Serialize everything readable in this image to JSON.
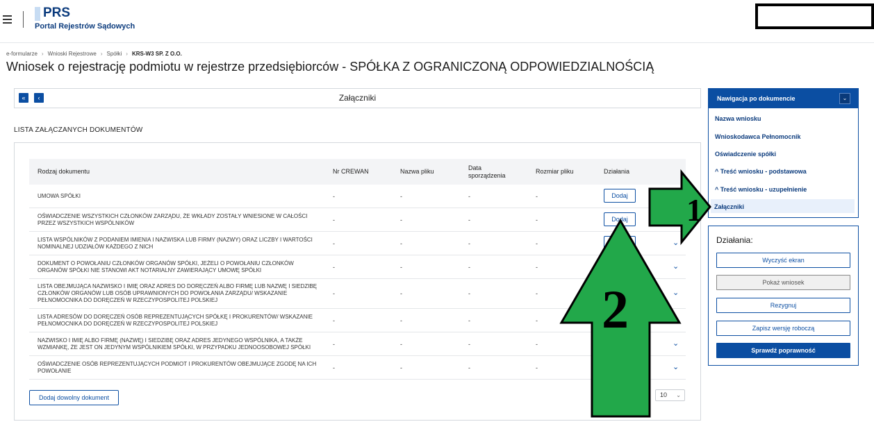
{
  "header": {
    "logo_title": "PRS",
    "logo_subtitle": "Portal Rejestrów Sądowych"
  },
  "breadcrumb": [
    "e-formularze",
    "Wnioski Rejestrowe",
    "Spółki",
    "KRS-W3 SP. Z O.O."
  ],
  "breadcrumb_separator": "›",
  "page_title": "Wniosek o rejestrację podmiotu w rejestrze przedsiębiorców - SPÓŁKA Z OGRANICZONĄ ODPOWIEDZIALNOŚCIĄ",
  "section": {
    "title": "Załączniki",
    "first_icon": "«",
    "prev_icon": "‹"
  },
  "list_heading": "LISTA ZAŁĄCZANYCH DOKUMENTÓW",
  "table": {
    "headers": {
      "doc_type": "Rodzaj dokumentu",
      "crewan": "Nr CREWAN",
      "file_name": "Nazwa pliku",
      "date": "Data sporządzenia",
      "size": "Rozmiar pliku",
      "actions": "Działania"
    },
    "dash": "-",
    "add_label": "Dodaj",
    "chevron": "⌄",
    "rows": [
      {
        "doc": "UMOWA SPÓŁKI"
      },
      {
        "doc": "OŚWIADCZENIE WSZYSTKICH CZŁONKÓW ZARZĄDU, ŻE WKŁADY ZOSTAŁY WNIESIONE W CAŁOŚCI PRZEZ WSZYSTKICH WSPÓLNIKÓW"
      },
      {
        "doc": "LISTA WSPÓLNIKÓW Z PODANIEM IMIENIA I NAZWISKA LUB FIRMY (NAZWY) ORAZ LICZBY I WARTOŚCI NOMINALNEJ UDZIAŁÓW KAŻDEGO Z NICH"
      },
      {
        "doc": "DOKUMENT O POWOŁANIU CZŁONKÓW ORGANÓW SPÓŁKI, JEŻELI O POWOŁANIU CZŁONKÓW ORGANÓW SPÓŁKI NIE STANOWI AKT NOTARIALNY ZAWIERAJĄCY UMOWĘ SPÓŁKI"
      },
      {
        "doc": "LISTA OBEJMUJĄCA NAZWISKO I IMIĘ ORAZ ADRES DO DORĘCZEŃ ALBO FIRMĘ LUB NAZWĘ I SIEDZIBĘ CZŁONKÓW ORGANÓW LUB OSÓB UPRAWNIONYCH DO POWOŁANIA ZARZĄDU/ WSKAZANIE PEŁNOMOCNIKA DO DORĘCZEŃ W RZECZYPOSPOLITEJ POLSKIEJ"
      },
      {
        "doc": "LISTA ADRESÓW DO DORĘCZEŃ OSÓB REPREZENTUJĄCYCH SPÓŁKĘ I PROKURENTÓW/ WSKAZANIE PEŁNOMOCNIKA DO DORĘCZEŃ W RZECZYPOSPOLITEJ POLSKIEJ"
      },
      {
        "doc": "NAZWISKO I IMIĘ ALBO FIRMĘ (NAZWĘ) I SIEDZIBĘ ORAZ ADRES JEDYNEGO WSPÓLNIKA, A TAKŻE WZMIANKĘ, ŻE JEST ON JEDYNYM WSPÓLNIKIEM SPÓŁKI, W PRZYPADKU JEDNOOSOBOWEJ SPÓŁKI"
      },
      {
        "doc": "OŚWIADCZENIE OSÓB REPREZENTUJĄCYCH PODMIOT I PROKURENTÓW OBEJMUJĄCE ZGODĘ NA ICH POWOŁANIE"
      }
    ],
    "add_any_label": "Dodaj dowolny dokument",
    "page_size": "10"
  },
  "nav_panel": {
    "title": "Nawigacja po dokumencie",
    "toggle_icon": "⌄",
    "items": [
      "Nazwa wniosku",
      "Wnioskodawca Pełnomocnik",
      "Oświadczenie spółki",
      "Treść wniosku - podstawowa",
      "Treść wniosku - uzupełnienie",
      "Załączniki"
    ],
    "group_prefix": "^"
  },
  "actions_panel": {
    "title": "Działania:",
    "buttons": [
      "Wyczyść ekran",
      "Pokaż wniosek",
      "Rezygnuj",
      "Zapisz wersję roboczą",
      "Sprawdź poprawność"
    ]
  },
  "annotations": {
    "arrow1_label": "1",
    "arrow2_label": "2",
    "color": "#22a84a"
  }
}
